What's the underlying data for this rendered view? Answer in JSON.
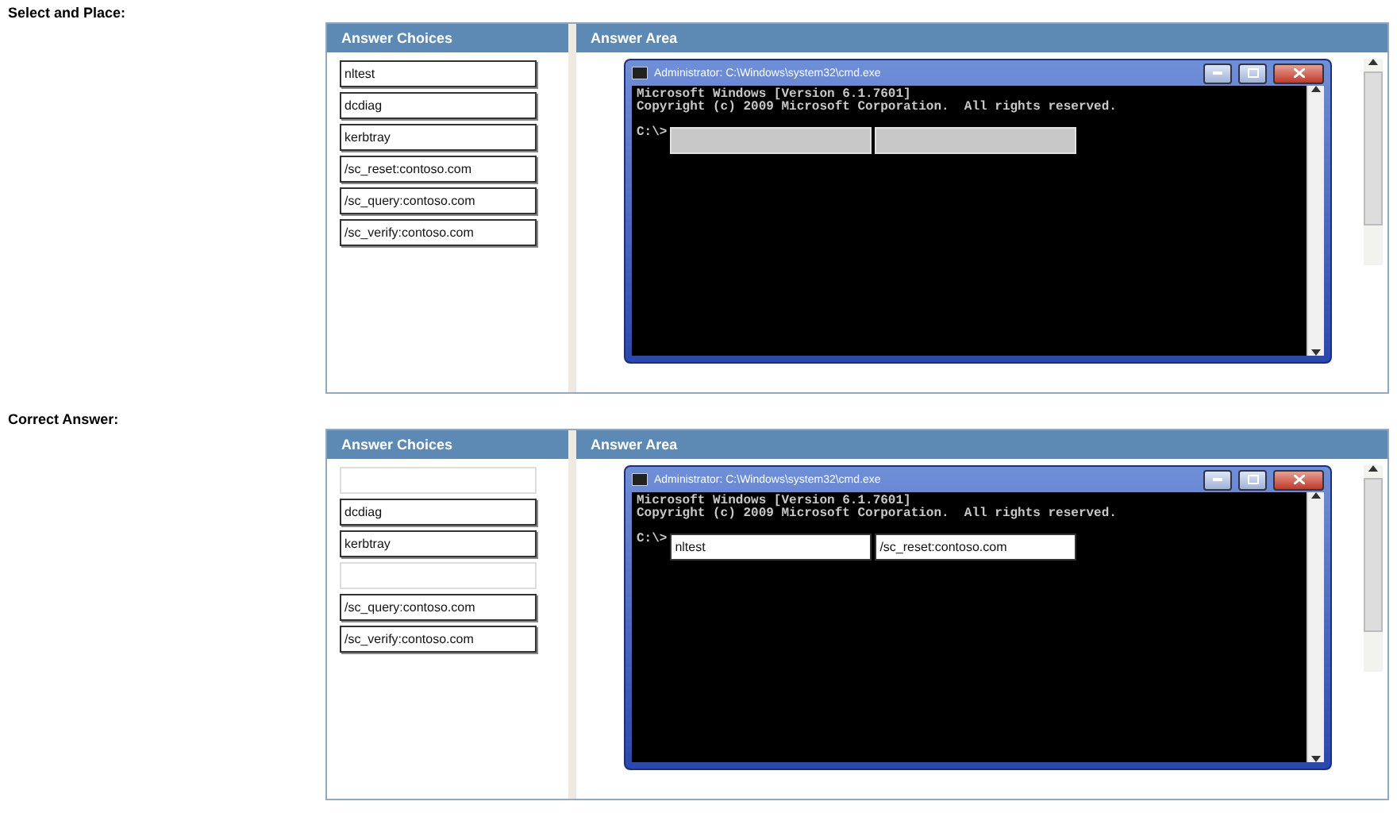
{
  "sections": [
    {
      "label": "Select and Place:",
      "choices_header": "Answer Choices",
      "area_header": "Answer Area",
      "choices": [
        {
          "text": "nltest",
          "used": false
        },
        {
          "text": "dcdiag",
          "used": false
        },
        {
          "text": "kerbtray",
          "used": false
        },
        {
          "text": "/sc_reset:contoso.com",
          "used": false
        },
        {
          "text": "/sc_query:contoso.com",
          "used": false
        },
        {
          "text": "/sc_verify:contoso.com",
          "used": false
        }
      ],
      "console": {
        "title": "Administrator: C:\\Windows\\system32\\cmd.exe",
        "lines": [
          "Microsoft Windows [Version 6.1.7601]",
          "Copyright (c) 2009 Microsoft Corporation.  All rights reserved."
        ],
        "prompt": "C:\\>",
        "slots": [
          {
            "filled": false
          },
          {
            "filled": false
          }
        ]
      }
    },
    {
      "label": "Correct Answer:",
      "choices_header": "Answer Choices",
      "area_header": "Answer Area",
      "choices": [
        {
          "used": true
        },
        {
          "text": "dcdiag",
          "used": false
        },
        {
          "text": "kerbtray",
          "used": false
        },
        {
          "used": true
        },
        {
          "text": "/sc_query:contoso.com",
          "used": false
        },
        {
          "text": "/sc_verify:contoso.com",
          "used": false
        }
      ],
      "console": {
        "title": "Administrator: C:\\Windows\\system32\\cmd.exe",
        "lines": [
          "Microsoft Windows [Version 6.1.7601]",
          "Copyright (c) 2009 Microsoft Corporation.  All rights reserved."
        ],
        "prompt": "C:\\>",
        "slots": [
          {
            "filled": true,
            "text": "nltest"
          },
          {
            "filled": true,
            "text": "/sc_reset:contoso.com"
          }
        ]
      }
    }
  ]
}
